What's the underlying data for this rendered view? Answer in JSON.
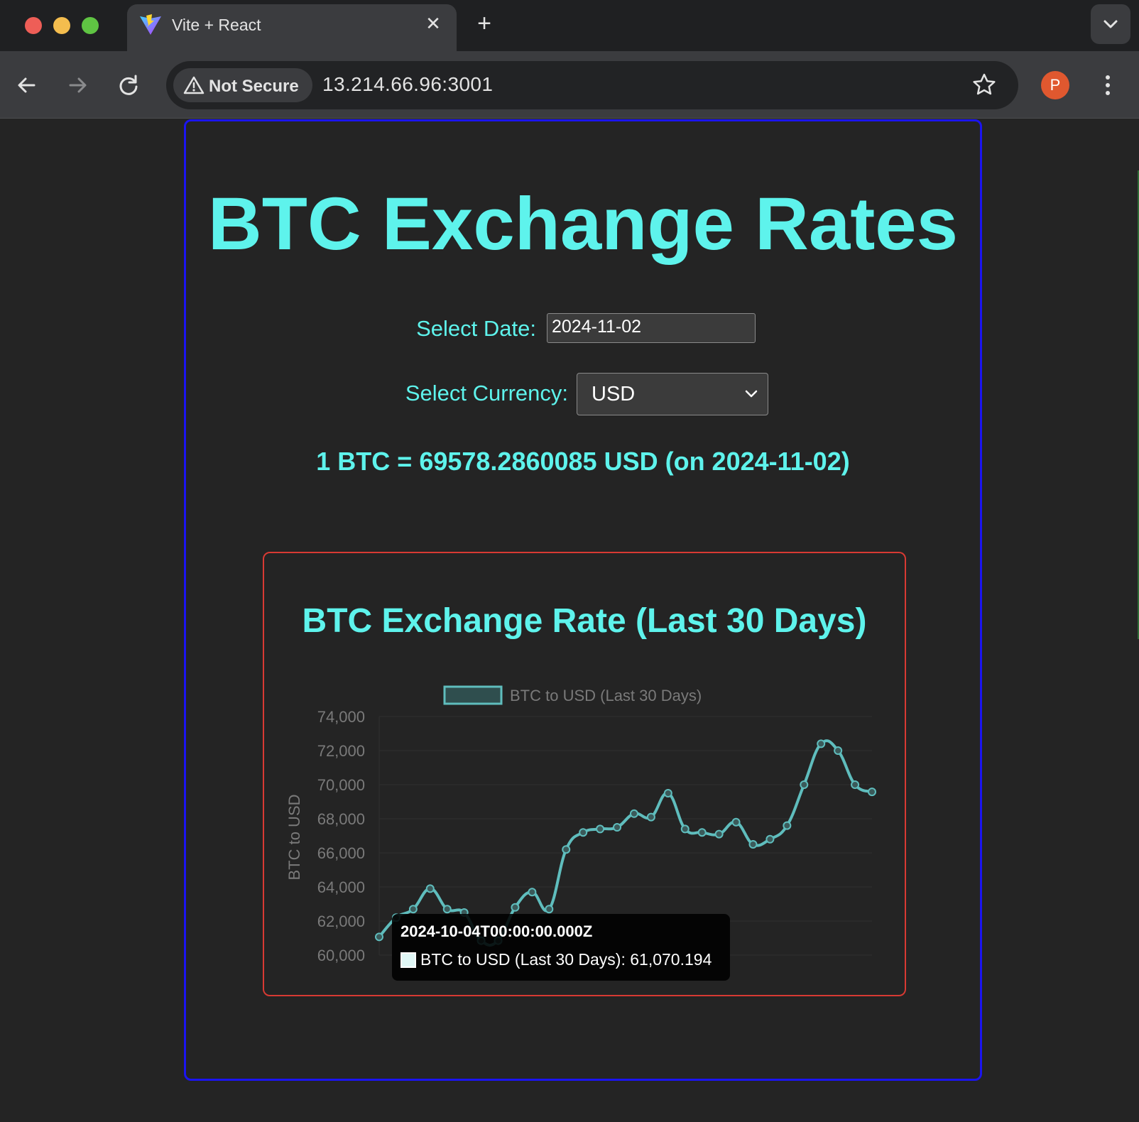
{
  "browser": {
    "tab_title": "Vite + React",
    "security_label": "Not Secure",
    "url": "13.214.66.96:3001",
    "profile_initial": "P",
    "icons": [
      "vite-icon",
      "close-icon",
      "plus-icon",
      "chevron-down-icon",
      "back-arrow-icon",
      "forward-arrow-icon",
      "reload-icon",
      "warning-icon",
      "star-icon",
      "more-vert-icon"
    ]
  },
  "app": {
    "title": "BTC Exchange Rates",
    "date_label": "Select Date:",
    "date_value": "2024-11-02",
    "currency_label": "Select Currency:",
    "currency_value": "USD",
    "rate_text": "1 BTC = 69578.2860085 USD (on 2024-11-02)"
  },
  "chart_section": {
    "title": "BTC Exchange Rate (Last 30 Days)"
  },
  "chart_data": {
    "type": "line",
    "series": [
      {
        "name": "BTC to USD (Last 30 Days)",
        "values": [
          61070.194,
          62200,
          62700,
          63900,
          62700,
          62500,
          60850,
          60850,
          62800,
          63700,
          62700,
          66200,
          67200,
          67400,
          67500,
          68300,
          68100,
          69500,
          67400,
          67200,
          67100,
          67800,
          66500,
          66800,
          67600,
          70000,
          72400,
          72000,
          70000,
          69578.286
        ]
      }
    ],
    "x_start_label": "2024-10-04T00:00:00.000Z",
    "ylabel": "BTC to USD",
    "yticks": [
      "74,000",
      "72,000",
      "70,000",
      "68,000",
      "66,000",
      "64,000",
      "62,000",
      "60,000"
    ],
    "ylim": [
      60000,
      74000
    ],
    "legend_position": "top",
    "grid": true,
    "line_color": "#5fbdbd"
  },
  "tooltip": {
    "title": "2024-10-04T00:00:00.000Z",
    "body": "BTC to USD (Last 30 Days): 61,070.194"
  }
}
